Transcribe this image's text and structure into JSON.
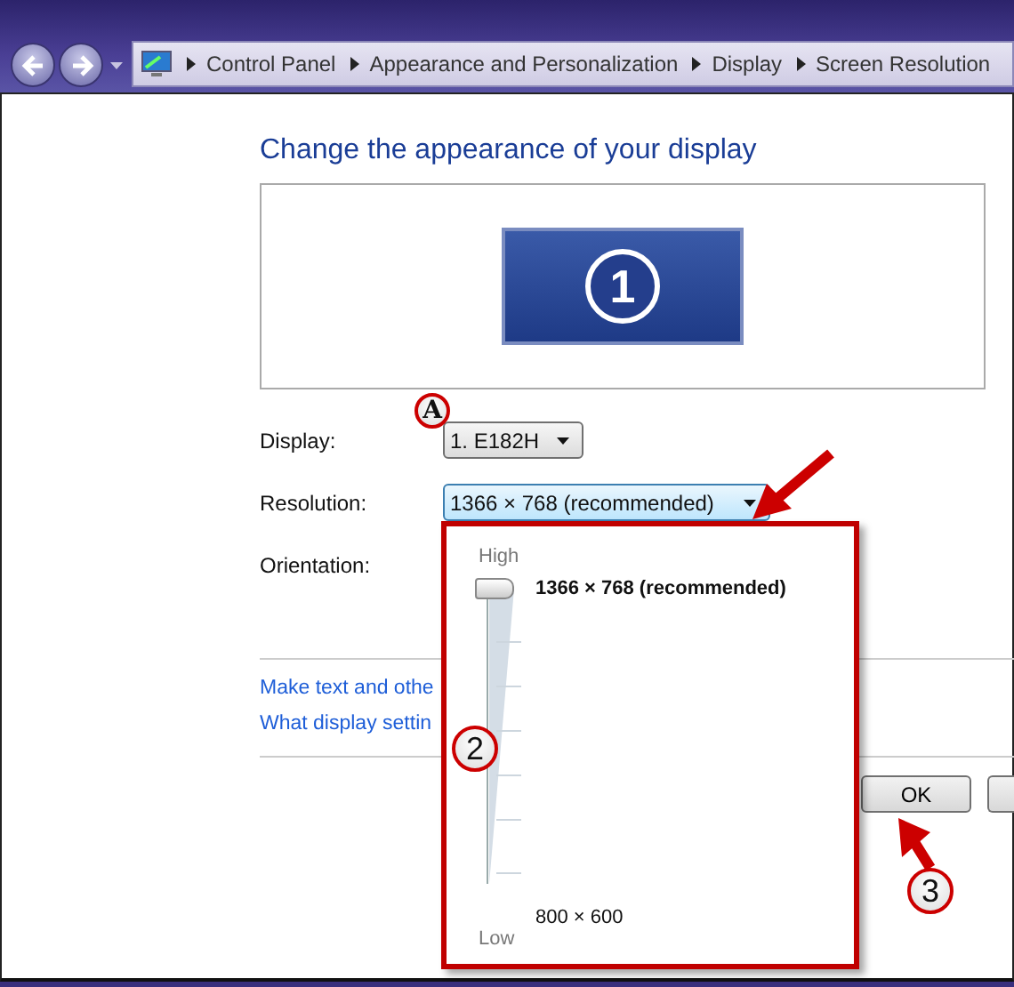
{
  "address_bar": {
    "crumbs": [
      "Control Panel",
      "Appearance and Personalization",
      "Display",
      "Screen Resolution"
    ]
  },
  "heading": "Change the appearance of your display",
  "preview": {
    "monitor_number": "1"
  },
  "fields": [
    {
      "kind": "dropdown",
      "label": "Display:",
      "value": "1. E182H"
    },
    {
      "kind": "dropdown",
      "label": "Resolution:",
      "value": "1366 × 768 (recommended)",
      "expanded": true
    },
    {
      "kind": "label",
      "label": "Orientation:"
    }
  ],
  "links": [
    "Make text and othe",
    "What display settin"
  ],
  "buttons": [
    {
      "kind": "button",
      "label": "OK"
    },
    {
      "kind": "partial"
    }
  ],
  "resolution_popup": {
    "top_label": "High",
    "bottom_label": "Low",
    "level": 1,
    "current": "1366 × 768 (recommended)",
    "minimum": "800 × 600"
  },
  "callouts": [
    "A",
    "2",
    "3"
  ]
}
